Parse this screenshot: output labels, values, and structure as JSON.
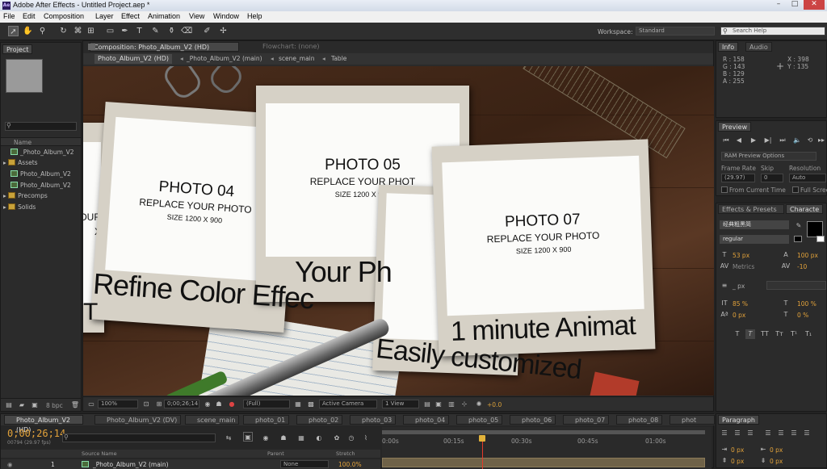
{
  "app": {
    "title": "Adobe After Effects - Untitled Project.aep *",
    "logo": "Ae"
  },
  "menu": [
    "File",
    "Edit",
    "Composition",
    "Layer",
    "Effect",
    "Animation",
    "View",
    "Window",
    "Help"
  ],
  "toolbar": {
    "workspace_label": "Workspace:",
    "workspace_value": "Standard",
    "search_placeholder": "Search Help"
  },
  "project": {
    "tab": "Project",
    "search_value": "",
    "column_name": "Name",
    "items": [
      {
        "name": "_Photo_Album_V2",
        "type": "comp"
      },
      {
        "name": "Assets",
        "type": "folder"
      },
      {
        "name": "Photo_Album_V2",
        "type": "comp"
      },
      {
        "name": "Photo_Album_V2",
        "type": "comp"
      },
      {
        "name": "Precomps",
        "type": "folder"
      },
      {
        "name": "Solids",
        "type": "folder"
      }
    ],
    "bpc": "8 bpc"
  },
  "composition": {
    "tab": "Composition: Photo_Album_V2 (HD)",
    "flowchart_tab": "Flowchart: (none)",
    "breadcrumbs": [
      "Photo_Album_V2 (HD)",
      "_Photo_Album_V2 (main)",
      "scene_main",
      "Table"
    ],
    "zoom": "100%",
    "timecode": "0;00;26;14",
    "resolution": "(Full)",
    "camera": "Active Camera",
    "views": "1 View",
    "exposure": "+0.0"
  },
  "scene": {
    "cards": [
      {
        "title": "PHOTO  04",
        "line": "REPLACE YOUR PHOTO",
        "size": "SIZE  1200 X 900"
      },
      {
        "title": "PHOTO  05",
        "line": "REPLACE YOUR PHOT",
        "size": "SIZE  1200 X 900"
      },
      {
        "title": "PHOTO  07",
        "line": "REPLACE YOUR PHOTO",
        "size": "SIZE  1200 X 900"
      }
    ],
    "left_partial": [
      "OUR",
      "X"
    ],
    "captions": [
      "Refine Color Effec",
      "Your Ph",
      "1 minute Animat",
      "Easily customized"
    ],
    "left_edge_letter": "T"
  },
  "info": {
    "tabs": [
      "Info",
      "Audio"
    ],
    "r": "R : 158",
    "g": "G : 143",
    "b": "B : 129",
    "a": "A : 255",
    "x": "X : 398",
    "y": "Y : 135"
  },
  "preview": {
    "tab": "Preview",
    "ram_options": "RAM Preview Options",
    "frame_rate_label": "Frame Rate",
    "skip_label": "Skip",
    "resolution_label": "Resolution",
    "frame_rate": "(29.97)",
    "skip": "0",
    "resolution": "Auto",
    "from_current": "From Current Time",
    "full_screen": "Full Scree"
  },
  "character": {
    "tabs": [
      "Effects & Presets",
      "Characte"
    ],
    "font": "经典粗黑简",
    "style": "regular",
    "size": "53 px",
    "leading": "100 px",
    "kerning": "Metrics",
    "tracking": "-10",
    "stroke": "_ px",
    "vscale": "85 %",
    "hscale": "100 %",
    "baseline": "0 px",
    "tsume": "0 %",
    "styles": [
      "T",
      "T",
      "TT",
      "Tт",
      "T¹",
      "T₁"
    ]
  },
  "paragraph": {
    "tab": "Paragraph",
    "indent1": "0 px",
    "indent2": "0 px",
    "indent3": "0 px",
    "indent4": "0 px"
  },
  "timeline": {
    "tabs": [
      "Photo_Album_V2 (HD)",
      "Photo_Album_V2 (DV)",
      "scene_main",
      "photo_01",
      "photo_02",
      "photo_03",
      "photo_04",
      "photo_05",
      "photo_06",
      "photo_07",
      "photo_08",
      "phot"
    ],
    "timecode": "0;00;26;14",
    "frames": "00794 (29.97 fps)",
    "search_value": "",
    "columns": {
      "source": "Source Name",
      "parent": "Parent",
      "stretch": "Stretch"
    },
    "ruler": [
      "0:00s",
      "00:15s",
      "00:30s",
      "00:45s",
      "01:00s"
    ],
    "playhead": 0.31,
    "layer": {
      "num": "1",
      "name": "_Photo_Album_V2 (main)",
      "parent": "None",
      "stretch": "100.0%"
    }
  },
  "colors": {
    "accent": "#e2a23a",
    "bg": "#2b2b2b",
    "wood": "#4a2d1c"
  }
}
